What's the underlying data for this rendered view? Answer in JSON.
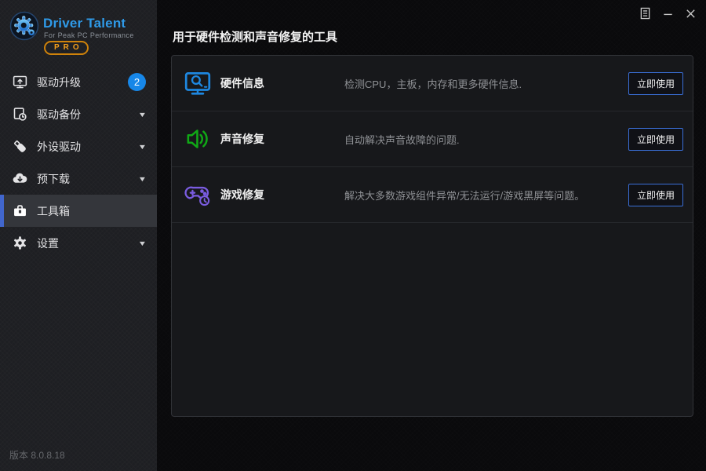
{
  "logo": {
    "title": "Driver Talent",
    "subtitle": "For Peak PC Performance",
    "badge": "PRO"
  },
  "sidebar": {
    "caret_glyph": "▼",
    "items": [
      {
        "label": "驱动升级",
        "badge": "2"
      },
      {
        "label": "驱动备份",
        "has_submenu": true
      },
      {
        "label": "外设驱动",
        "has_submenu": true
      },
      {
        "label": "预下载",
        "has_submenu": true
      },
      {
        "label": "工具箱",
        "selected": true
      },
      {
        "label": "设置",
        "has_submenu": true
      }
    ],
    "version": "版本 8.0.8.18"
  },
  "main": {
    "title": "用于硬件检测和声音修复的工具",
    "tools": [
      {
        "name": "硬件信息",
        "description": "检测CPU，主板，内存和更多硬件信息.",
        "action": "立即使用",
        "icon": "hardware-info-icon",
        "color": "#1e87e0"
      },
      {
        "name": "声音修复",
        "description": "自动解决声音故障的问题.",
        "action": "立即使用",
        "icon": "sound-repair-icon",
        "color": "#10a816"
      },
      {
        "name": "游戏修复",
        "description": "解决大多数游戏组件异常/无法运行/游戏黑屏等问题。",
        "action": "立即使用",
        "icon": "game-repair-icon",
        "color": "#7a5ce0"
      }
    ]
  },
  "colors": {
    "accent_blue": "#1787e8",
    "selected_bar": "#4166cd",
    "button_border": "#3a6fd8",
    "pro_orange": "#f7a01b",
    "sidebar_bg": "#1e1f23",
    "panel_bg": "#17181b",
    "green_icon": "#10a816",
    "purple_icon": "#7a5ce0"
  }
}
